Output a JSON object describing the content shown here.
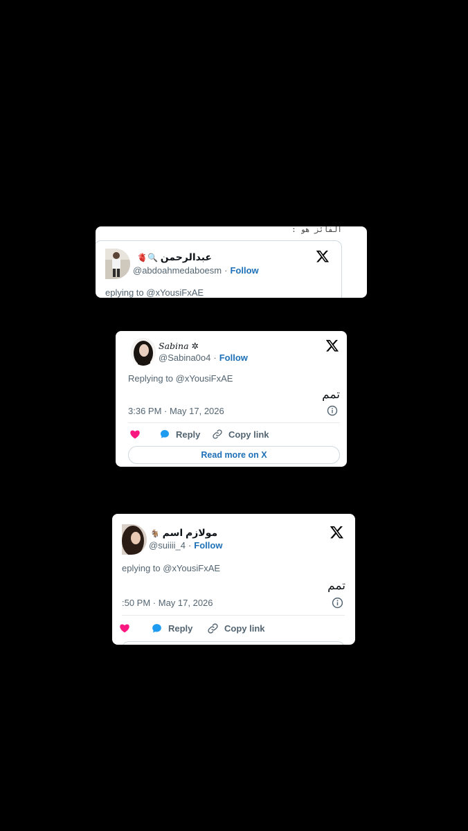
{
  "cards": [
    {
      "header_text": "الفائز هو :",
      "name": "عبدالرحمن",
      "name_emoji": "🫀🔍",
      "handle": "@abdoahmedaboesm",
      "follow_label": "Follow",
      "replying_to": "eplying to @xYousiFxAE"
    },
    {
      "name": "Sabina",
      "name_suffix": "✲",
      "handle": "@Sabina0o4",
      "follow_label": "Follow",
      "replying_to": "Replying to @xYousiFxAE",
      "text": "تمم",
      "timestamp": "3:36 PM · May 17, 2026",
      "reply_label": "Reply",
      "copy_label": "Copy link",
      "read_more_label": "Read more on X"
    },
    {
      "name": "مولازم اسم",
      "name_prefix": "🐐",
      "handle": "@suiiii_4",
      "follow_label": "Follow",
      "replying_to": "eplying to @xYousiFxAE",
      "text": "تمم",
      "timestamp": ":50 PM · May 17, 2026",
      "reply_label": "Reply",
      "copy_label": "Copy link"
    }
  ],
  "colors": {
    "background": "#000000",
    "follow": "#1d70b8",
    "heart": "#f91880",
    "reply": "#1d9bf0"
  },
  "icons": [
    "x-logo-icon",
    "info-icon",
    "heart-icon",
    "reply-bubble-icon",
    "link-icon"
  ]
}
